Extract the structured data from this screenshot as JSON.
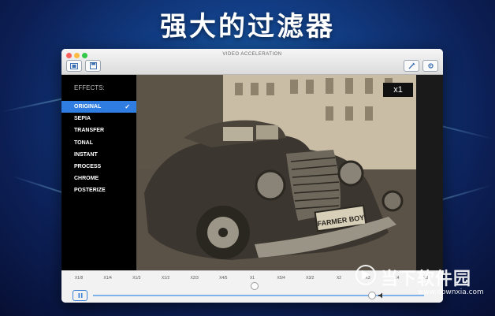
{
  "headline": "强大的过滤器",
  "window": {
    "title": "VIDEO ACCELERATION",
    "traffic_lights": [
      "#fc605c",
      "#fdbc40",
      "#34c84a"
    ]
  },
  "effects": {
    "heading": "EFFECTS:",
    "items": [
      "ORIGINAL",
      "SEPIA",
      "TRANSFER",
      "TONAL",
      "INSTANT",
      "PROCESS",
      "CHROME",
      "POSTERIZE"
    ],
    "selected": "ORIGINAL",
    "selected_color": "#2f7de1"
  },
  "video": {
    "speed_badge": "x1",
    "plate_text": "FARMER BOY"
  },
  "speed_scale": {
    "labels": [
      "X1/8",
      "X1/4",
      "X1/3",
      "X1/2",
      "X2/3",
      "X4/5",
      "X1",
      "X5/4",
      "X3/2",
      "X2",
      "X3",
      "X4",
      "X8"
    ],
    "selected": "X1"
  },
  "playback": {
    "progress": 0.84
  },
  "watermark": {
    "brand_cn": "当下软件园",
    "url": "www.downxia.com"
  },
  "colors": {
    "accent": "#2f7de1",
    "background": "#0c1f55"
  }
}
